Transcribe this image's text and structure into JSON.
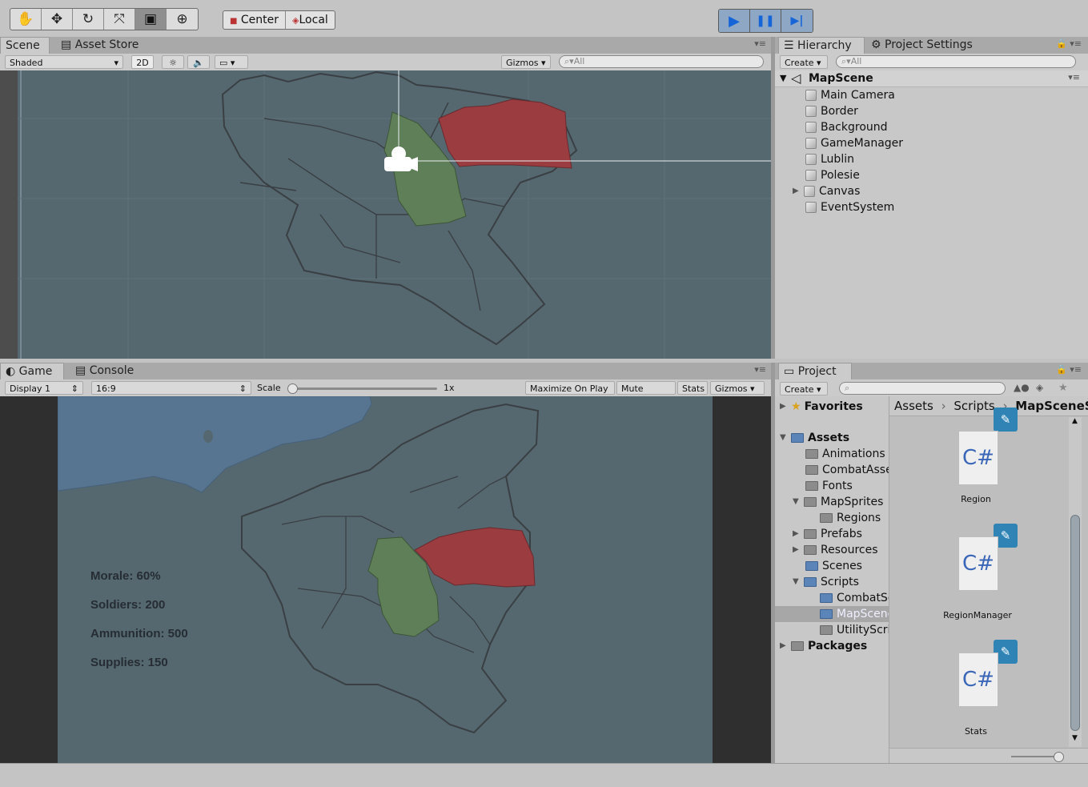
{
  "toolbar": {
    "tools": [
      {
        "icon": "hand-tool-icon",
        "glyph": "✋"
      },
      {
        "icon": "move-tool-icon",
        "glyph": "✥"
      },
      {
        "icon": "rotate-tool-icon",
        "glyph": "↻"
      },
      {
        "icon": "scale-tool-icon",
        "glyph": "⤧"
      },
      {
        "icon": "rect-tool-icon",
        "glyph": "▣"
      },
      {
        "icon": "transform-tool-icon",
        "glyph": "⊕"
      }
    ],
    "pivot_label": "Center",
    "space_label": "Local",
    "play_controls": [
      {
        "icon": "play-icon",
        "glyph": "▶"
      },
      {
        "icon": "pause-icon",
        "glyph": "❚❚"
      },
      {
        "icon": "step-icon",
        "glyph": "▶|"
      }
    ]
  },
  "scene_panel": {
    "tabs": [
      "Scene",
      "Asset Store"
    ],
    "shading": "Shaded",
    "mode_2d": "2D",
    "gizmos": "Gizmos",
    "search_placeholder": "All"
  },
  "hierarchy": {
    "tabs": [
      "Hierarchy",
      "Project Settings"
    ],
    "create": "Create",
    "search_placeholder": "All",
    "scene": "MapScene",
    "items": [
      "Main Camera",
      "Border",
      "Background",
      "GameManager",
      "Lublin",
      "Polesie",
      "Canvas",
      "EventSystem"
    ]
  },
  "game_panel": {
    "tabs": [
      "Game",
      "Console"
    ],
    "display": "Display 1",
    "aspect": "16:9",
    "scale_label": "Scale",
    "scale_value": "1x",
    "maximize": "Maximize On Play",
    "mute": "Mute Audio",
    "stats": "Stats",
    "gizmos": "Gizmos",
    "hud": [
      "Morale: 60%",
      "Soldiers: 200",
      "Ammunition: 500",
      "Supplies: 150"
    ]
  },
  "project": {
    "tab": "Project",
    "create": "Create",
    "favorites": "Favorites",
    "tree": [
      {
        "label": "Assets",
        "bold": true
      },
      {
        "label": "Animations"
      },
      {
        "label": "CombatAssets"
      },
      {
        "label": "Fonts"
      },
      {
        "label": "MapSprites"
      },
      {
        "label": "Regions"
      },
      {
        "label": "Prefabs"
      },
      {
        "label": "Resources"
      },
      {
        "label": "Scenes"
      },
      {
        "label": "Scripts"
      },
      {
        "label": "CombatScripts"
      },
      {
        "label": "MapSceneScripts"
      },
      {
        "label": "UtilityScripts"
      },
      {
        "label": "Packages",
        "bold": true
      }
    ],
    "breadcrumb": [
      "Assets",
      "Scripts",
      "MapSceneScripts"
    ],
    "assets": [
      {
        "glyph": "C#",
        "name": "Region"
      },
      {
        "glyph": "C#",
        "name": "RegionManager"
      },
      {
        "glyph": "C#",
        "name": "Stats"
      }
    ]
  },
  "colors": {
    "map_bg": "#55686f",
    "sea": "#577591",
    "region_red": "#9b3c40",
    "region_green": "#5f7f58",
    "accent": "#2f84b5"
  }
}
